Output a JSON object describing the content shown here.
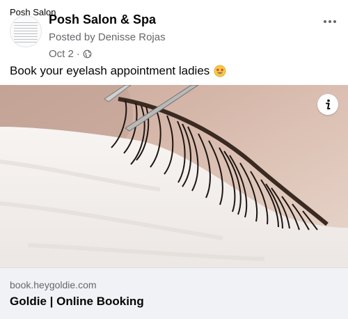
{
  "header": {
    "top_label": "Posh Salon",
    "page_name": "Posh Salon & Spa",
    "posted_by": "Posted by Denisse Rojas",
    "date": "Oct 2",
    "separator": "·"
  },
  "post": {
    "text": "Book your eyelash appointment ladies"
  },
  "link_preview": {
    "domain": "book.heygoldie.com",
    "title": "Goldie | Online Booking"
  },
  "icons": {
    "more": "more-options-icon",
    "globe": "globe-icon",
    "emoji": "star-struck-emoji",
    "info": "info-icon"
  }
}
